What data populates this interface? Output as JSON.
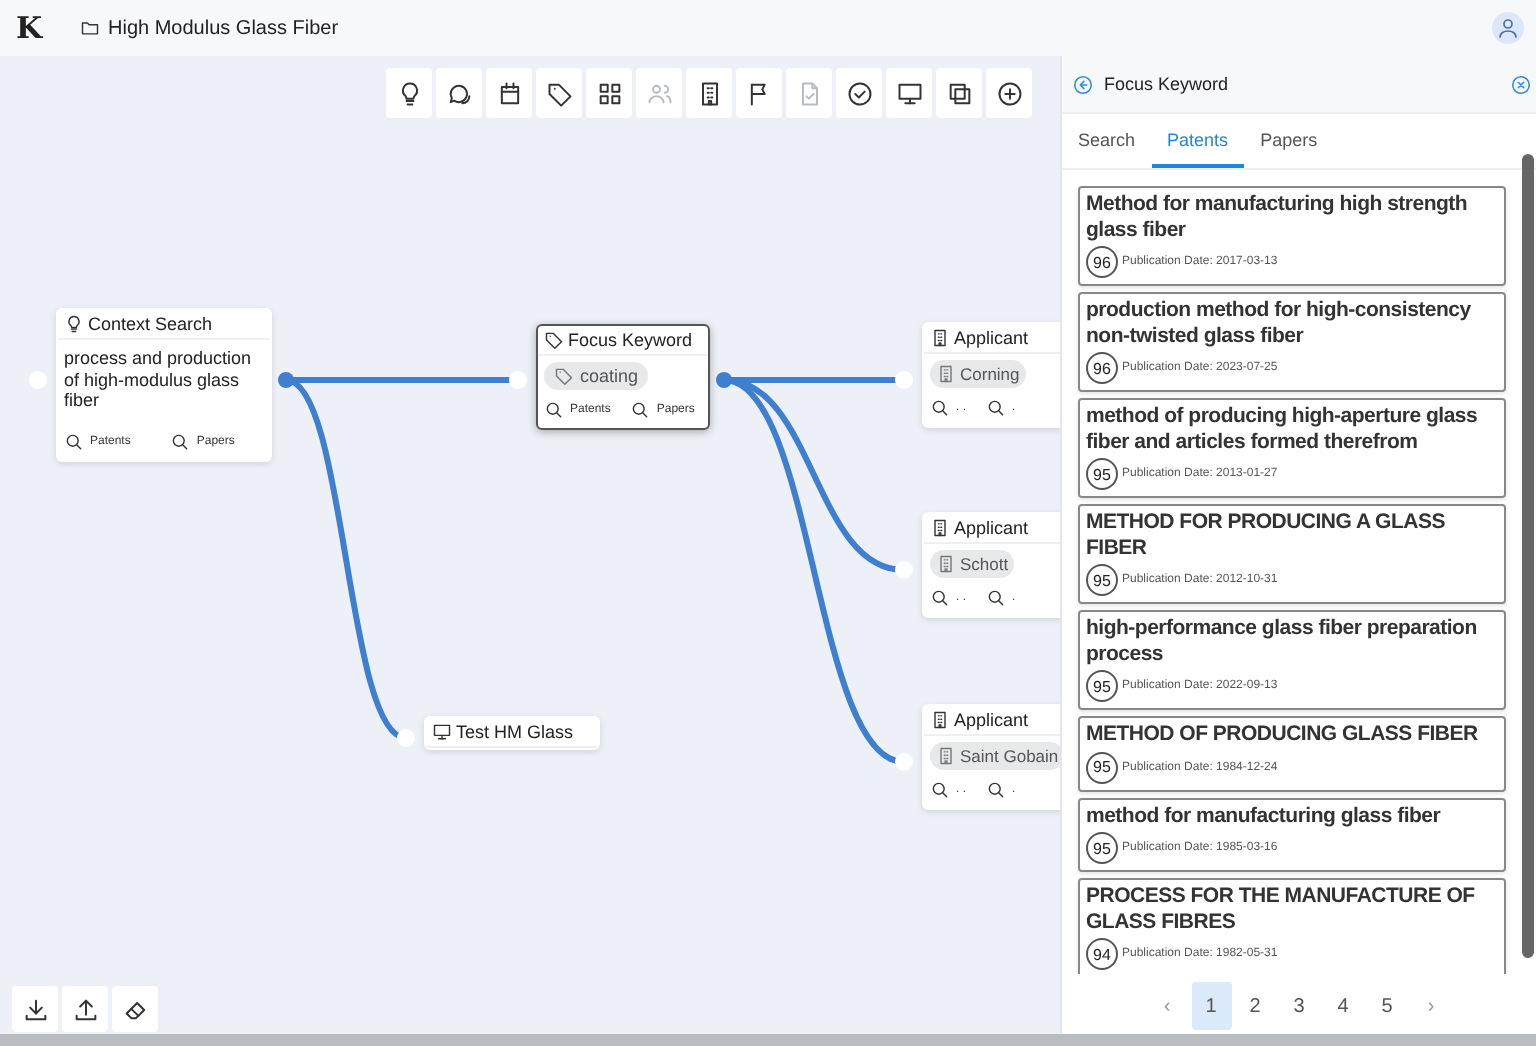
{
  "header": {
    "logo": "K",
    "project": "High Modulus Glass Fiber"
  },
  "toolbar": [
    {
      "disabled": false
    },
    {
      "disabled": false
    },
    {
      "disabled": false
    },
    {
      "disabled": false
    },
    {
      "disabled": false
    },
    {
      "disabled": true
    },
    {
      "disabled": false
    },
    {
      "disabled": false
    },
    {
      "disabled": true
    },
    {
      "disabled": false
    },
    {
      "disabled": false
    },
    {
      "disabled": false
    },
    {
      "disabled": false
    }
  ],
  "nodes": [
    {
      "kind": "context",
      "title": "Context Search",
      "text": "process and production of high-modulus glass fiber",
      "actions": [
        "Patents",
        "Papers"
      ],
      "selected": false
    },
    {
      "kind": "keyword",
      "title": "Focus Keyword",
      "chip": "coating",
      "actions": [
        "Patents",
        "Papers"
      ],
      "selected": true
    },
    {
      "kind": "note",
      "title": "Test HM Glass",
      "selected": false
    },
    {
      "kind": "applicant",
      "title": "Applicant",
      "chip": "Corning",
      "actions": [
        ". .",
        "."
      ],
      "selected": false
    },
    {
      "kind": "applicant",
      "title": "Applicant",
      "chip": "Schott",
      "actions": [
        ". .",
        "."
      ],
      "selected": false
    },
    {
      "kind": "applicant",
      "title": "Applicant",
      "chip": "Saint Gobain",
      "actions": [
        ". .",
        "."
      ],
      "selected": false
    }
  ],
  "panel": {
    "title": "Focus Keyword",
    "tabs": [
      {
        "label": "Search",
        "selected": false
      },
      {
        "label": "Patents",
        "selected": true
      },
      {
        "label": "Papers",
        "selected": false
      }
    ],
    "results": [
      {
        "title": "Method for manufacturing high strength glass fiber",
        "score": "96",
        "date": "Publication Date: 2017-03-13"
      },
      {
        "title": "production method for high-consistency non-twisted glass fiber",
        "score": "96",
        "date": "Publication Date: 2023-07-25"
      },
      {
        "title": "method of producing high-aperture glass fiber and articles formed therefrom",
        "score": "95",
        "date": "Publication Date: 2013-01-27"
      },
      {
        "title": "METHOD FOR PRODUCING A GLASS FIBER",
        "score": "95",
        "date": "Publication Date: 2012-10-31"
      },
      {
        "title": "high-performance glass fiber preparation process",
        "score": "95",
        "date": "Publication Date: 2022-09-13"
      },
      {
        "title": "METHOD OF PRODUCING GLASS FIBER",
        "score": "95",
        "date": "Publication Date: 1984-12-24"
      },
      {
        "title": "method for manufacturing glass fiber",
        "score": "95",
        "date": "Publication Date: 1985-03-16"
      },
      {
        "title": "PROCESS FOR THE MANUFACTURE OF GLASS FIBRES",
        "score": "94",
        "date": "Publication Date: 1982-05-31"
      }
    ],
    "pagination": {
      "prev": "‹",
      "next": "›",
      "pages": [
        {
          "label": "1",
          "selected": true
        },
        {
          "label": "2",
          "selected": false
        },
        {
          "label": "3",
          "selected": false
        },
        {
          "label": "4",
          "selected": false
        },
        {
          "label": "5",
          "selected": false
        }
      ]
    }
  }
}
